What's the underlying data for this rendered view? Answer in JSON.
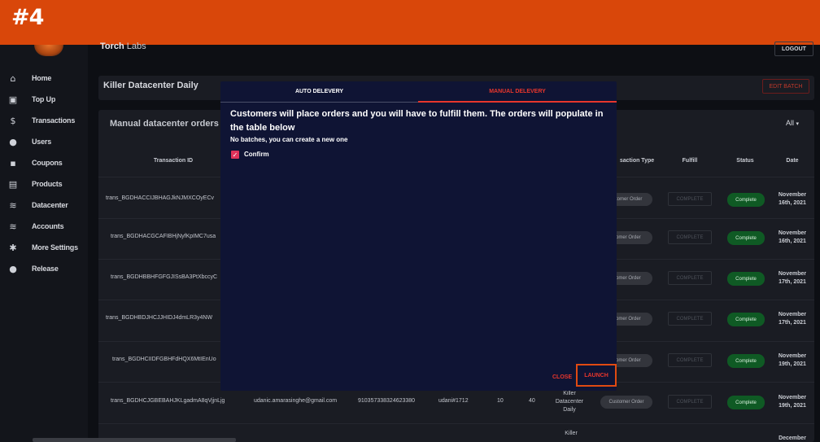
{
  "banner": {
    "label": "#4"
  },
  "header": {
    "brand_bold": "Torch",
    "brand_rest": " Labs",
    "logout": "LOGOUT"
  },
  "sidebar": {
    "items": [
      {
        "label": "Home",
        "icon": "home-icon",
        "glyph": "⌂"
      },
      {
        "label": "Top Up",
        "icon": "wallet-icon",
        "glyph": "▣"
      },
      {
        "label": "Transactions",
        "icon": "dollar-icon",
        "glyph": "$"
      },
      {
        "label": "Users",
        "icon": "user-icon",
        "glyph": "●"
      },
      {
        "label": "Coupons",
        "icon": "coupon-icon",
        "glyph": "▪"
      },
      {
        "label": "Products",
        "icon": "briefcase-icon",
        "glyph": "▤"
      },
      {
        "label": "Datacenter",
        "icon": "wifi-icon",
        "glyph": "≋"
      },
      {
        "label": "Accounts",
        "icon": "wifi-icon",
        "glyph": "≋"
      },
      {
        "label": "More Settings",
        "icon": "gear-icon",
        "glyph": "✱"
      },
      {
        "label": "Release",
        "icon": "globe-icon",
        "glyph": "●"
      }
    ]
  },
  "batch": {
    "title": "Killer Datacenter Daily",
    "edit": "EDIT BATCH"
  },
  "orders": {
    "title": "Manual datacenter orders t",
    "filter": "All",
    "headers": {
      "transaction_id": "Transaction ID",
      "transaction_type": "saction Type",
      "fulfill": "Fulfill",
      "status": "Status",
      "date": "Date"
    },
    "rows": [
      {
        "id": "trans_BGDHACCIJBHAGJkNJMXCOyECv",
        "type": "ustomer Order",
        "fulfill": "COMPLETE",
        "status": "Complete",
        "date1": "November",
        "date2": "16th, 2021"
      },
      {
        "id": "trans_BGDHACGCAFIBHjNyfKpIMC7usa",
        "type": "stomer Order",
        "fulfill": "COMPLETE",
        "status": "Complete",
        "date1": "November",
        "date2": "16th, 2021"
      },
      {
        "id": "trans_BGDHBBHFGFGJISsBA3PtXbccyC",
        "type": "stomer Order",
        "fulfill": "COMPLETE",
        "status": "Complete",
        "date1": "November",
        "date2": "17th, 2021"
      },
      {
        "id": "trans_BGDHBDJHCJJHIDJ4dmLR3y4NW",
        "type": "stomer Order",
        "fulfill": "COMPLETE",
        "status": "Complete",
        "date1": "November",
        "date2": "17th, 2021"
      },
      {
        "id": "trans_BGDHCIIDFGBHFdHQX6MtIEnUo",
        "type": "stomer Order",
        "fulfill": "COMPLETE",
        "status": "Complete",
        "date1": "November",
        "date2": "19th, 2021"
      },
      {
        "id": "trans_BGDHCJGBEBAHJKLgadmA8qVjjnLjg",
        "email": "udanic.amarasinghe@gmail.com",
        "phone": "910357338324623380",
        "user": "udani#1712",
        "n1": "10",
        "n2": "40",
        "product1": "Killer",
        "product2": "Datacenter",
        "product3": "Daily",
        "type": "Customer Order",
        "fulfill": "COMPLETE",
        "status": "Complete",
        "date1": "November",
        "date2": "19th, 2021"
      }
    ],
    "partial_product": "Killer",
    "partial_date": "December"
  },
  "modal": {
    "tab_auto": "AUTO DELEVERY",
    "tab_manual": "MANUAL DELEVERY",
    "text": "Customers will place orders and you will have to fulfill them. The orders will populate in the table below",
    "sub": "No batches, you can create a new one",
    "confirm": "Confirm",
    "close": "CLOSE",
    "launch": "LAUNCH"
  },
  "colors": {
    "banner": "#d9470a",
    "accent_red": "#e8362c",
    "modal_bg": "#0f1434",
    "status_green": "#0f5a24",
    "checkbox": "#e0325a"
  }
}
